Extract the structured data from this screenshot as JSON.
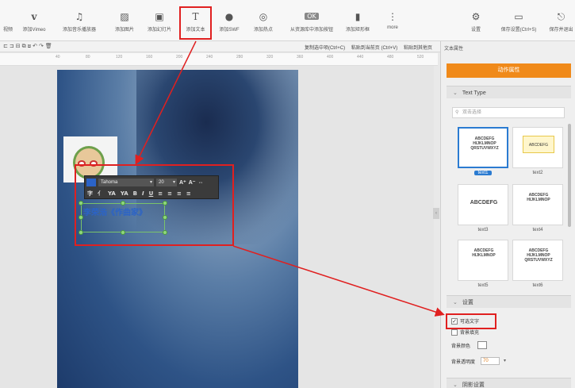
{
  "toolbar": {
    "items": [
      {
        "label": "视频",
        "icon": "video-icon"
      },
      {
        "label": "添加Vimeo",
        "icon": "vimeo-icon"
      },
      {
        "label": "添加音乐播放器",
        "icon": "music-icon"
      },
      {
        "label": "添加图片",
        "icon": "image-icon"
      },
      {
        "label": "添加幻灯片",
        "icon": "slideshow-icon"
      },
      {
        "label": "添加文本",
        "icon": "text-icon"
      },
      {
        "label": "添加SWF",
        "icon": "swf-icon"
      },
      {
        "label": "添加热点",
        "icon": "hotspot-icon"
      },
      {
        "label": "从资源库中添加按钮",
        "icon": "button-icon"
      },
      {
        "label": "添加矩形框",
        "icon": "rectangle-icon"
      },
      {
        "label": "more",
        "icon": "more-icon"
      },
      {
        "label": "设置",
        "icon": "settings-icon"
      },
      {
        "label": "保存设置(Ctrl+S)",
        "icon": "save-icon"
      },
      {
        "label": "保存并退出",
        "icon": "save-exit-icon"
      }
    ]
  },
  "subbar": {
    "copy": "复制选中项(Ctrl+C)",
    "paste": "粘贴到当前页 (Ctrl+V)",
    "paste_other": "粘贴到其他页"
  },
  "ruler": {
    "ticks": [
      "40",
      "80",
      "120",
      "160",
      "200",
      "240",
      "280",
      "320",
      "360",
      "400",
      "440",
      "480",
      "520"
    ]
  },
  "editor": {
    "font_name": "Tahoma",
    "font_size": "20",
    "text_content": "李荣浩《作曲家》",
    "format_buttons": [
      "A⁺",
      "A⁻",
      "⇔"
    ],
    "format_row2": [
      "字",
      "亻",
      "YA",
      "YA",
      "B",
      "I",
      "U",
      "≡",
      "≡",
      "≡",
      "≡"
    ]
  },
  "panel": {
    "title": "文本属性",
    "animation_tab": "动作属性",
    "text_type_header": "Text Type",
    "search_placeholder": "双击选择",
    "thumbs": [
      {
        "label": "text1",
        "art": "ABCDEFG HIJKLMNOP QRSTUVWXYZ"
      },
      {
        "label": "text2",
        "art": "ABCDEFG"
      },
      {
        "label": "text3",
        "art": "ABCDEFG"
      },
      {
        "label": "text4",
        "art": "ABCDEFG HIJKLMNOP"
      },
      {
        "label": "text5",
        "art": "ABCDEFG HIJKLMNOP"
      },
      {
        "label": "text6",
        "art": "ABCDEFG HIJKLMNOP QRSTUVWXYZ"
      }
    ],
    "settings_header": "设置",
    "selectable_text": "可选文字",
    "bg_fill": "背景填充",
    "bg_color": "背景颜色",
    "bg_opacity": "背景透明度",
    "opacity_value": "70",
    "shadow_header": "阴影设置"
  },
  "colors": {
    "accent": "#f08a1a",
    "highlight": "#e02020",
    "selected": "#2b7bd1",
    "text_blue": "#2b63c7"
  }
}
